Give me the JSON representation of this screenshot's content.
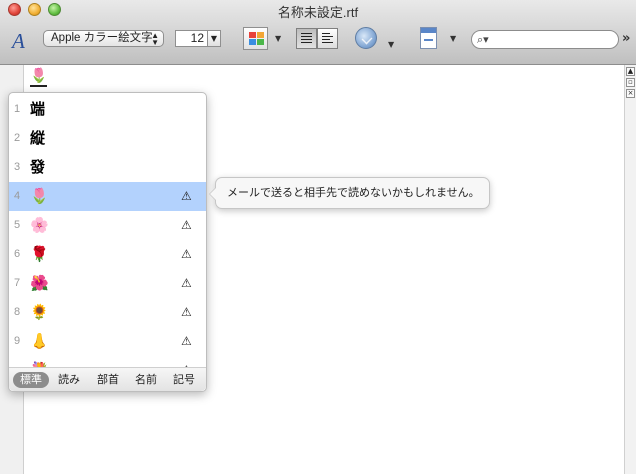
{
  "window": {
    "title": "名称未設定.rtf",
    "close_icon": "close-traffic-light",
    "minimize_icon": "minimize-traffic-light",
    "zoom_icon": "zoom-traffic-light"
  },
  "toolbar": {
    "font_panel_glyph": "A",
    "font_family": "Apple カラー絵文字",
    "font_size": "12",
    "dropdown_arrow": "▼",
    "overflow": "»",
    "search_placeholder": "",
    "color_well_colors": [
      "#e8413a",
      "#f3a635",
      "#3a8ee0",
      "#4cb74a"
    ]
  },
  "document": {
    "text": "🌷"
  },
  "candidates": {
    "items": [
      {
        "num": "1",
        "glyph": "端",
        "warning": ""
      },
      {
        "num": "2",
        "glyph": "縦",
        "warning": ""
      },
      {
        "num": "3",
        "glyph": "發",
        "warning": ""
      },
      {
        "num": "4",
        "glyph": "🌷",
        "warning": "⚠",
        "selected": true
      },
      {
        "num": "5",
        "glyph": "🌸",
        "warning": "⚠"
      },
      {
        "num": "6",
        "glyph": "🌹",
        "warning": "⚠"
      },
      {
        "num": "7",
        "glyph": "🌺",
        "warning": "⚠"
      },
      {
        "num": "8",
        "glyph": "🌻",
        "warning": "⚠"
      },
      {
        "num": "9",
        "glyph": "👃",
        "warning": "⚠"
      },
      {
        "num": "",
        "glyph": "💐",
        "warning": "⚠"
      }
    ],
    "tabs": [
      {
        "label": "標準",
        "active": true
      },
      {
        "label": "読み"
      },
      {
        "label": "部首"
      },
      {
        "label": "名前"
      },
      {
        "label": "記号"
      }
    ]
  },
  "tooltip": {
    "text": "メールで送ると相手先で読めないかもしれません。"
  }
}
